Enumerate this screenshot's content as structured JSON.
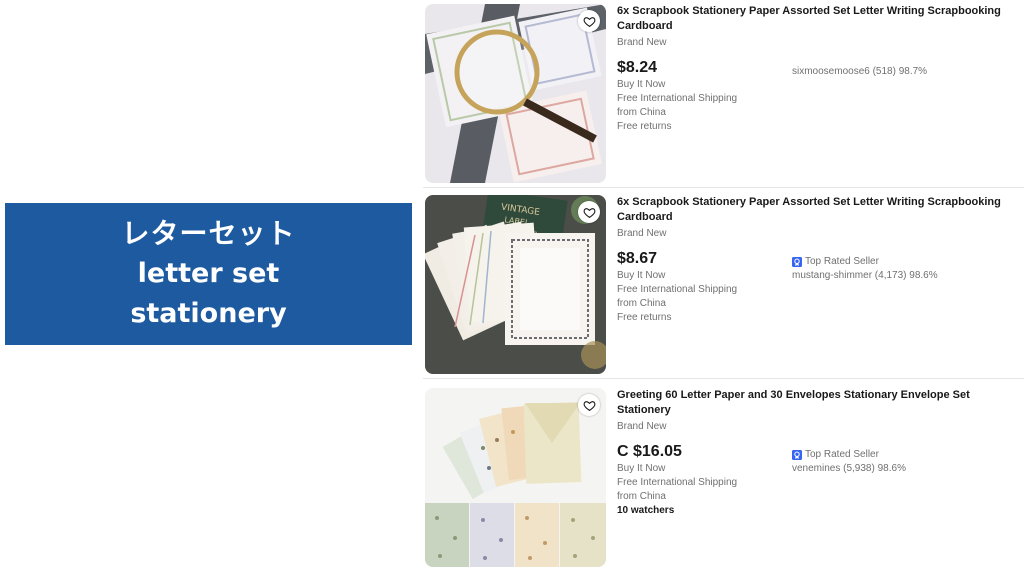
{
  "banner": {
    "line1": "レターセット",
    "line2": "letter set",
    "line3": "stationery",
    "color": "#1e5aa0"
  },
  "listings": [
    {
      "title": "6x Scrapbook Stationery Paper Assorted Set Letter Writing Scrapbooking Cardboard",
      "condition": "Brand New",
      "price": "$8.24",
      "buy_format": "Buy It Now",
      "shipping": "Free International Shipping",
      "origin": "from China",
      "returns": "Free returns",
      "watchers": "",
      "top_rated": "",
      "seller": "sixmoosemoose6 (518) 98.7%",
      "image": "magnifier-stationery-photo"
    },
    {
      "title": "6x Scrapbook Stationery Paper Assorted Set Letter Writing Scrapbooking Cardboard",
      "condition": "Brand New",
      "price": "$8.67",
      "buy_format": "Buy It Now",
      "shipping": "Free International Shipping",
      "origin": "from China",
      "returns": "Free returns",
      "watchers": "",
      "top_rated": "Top Rated Seller",
      "seller": "mustang-shimmer (4,173) 98.6%",
      "image": "fanned-stationery-photo"
    },
    {
      "title": "Greeting 60 Letter Paper and 30 Envelopes Stationary Envelope Set Stationery",
      "condition": "Brand New",
      "price": "C $16.05",
      "buy_format": "Buy It Now",
      "shipping": "Free International Shipping",
      "origin": "from China",
      "returns": "",
      "watchers": "10 watchers",
      "top_rated": "Top Rated Seller",
      "seller": "venemines (5,938) 98.6%",
      "image": "envelope-set-photo"
    }
  ],
  "icons": {
    "watch": "heart-icon",
    "top_rated": "top-rated-badge-icon"
  },
  "colors": {
    "top_rated_blue": "#3665f3",
    "muted_text": "#707070"
  }
}
